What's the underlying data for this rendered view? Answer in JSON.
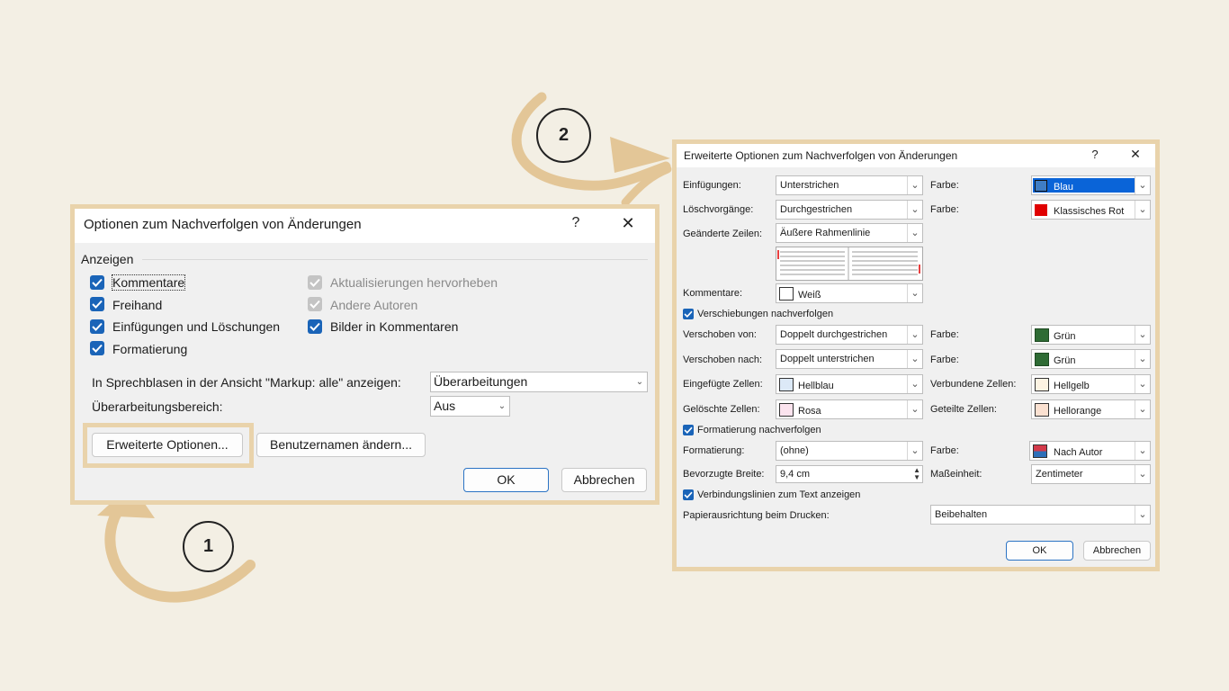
{
  "colors": {
    "background": "#f3efe4",
    "frame": "#e9d3ab",
    "checkbox": "#1a64b8",
    "arrow": "#e3c697"
  },
  "steps": {
    "one": "1",
    "two": "2"
  },
  "dialog1": {
    "title": "Optionen zum Nachverfolgen von Änderungen",
    "help": "?",
    "close": "✕",
    "section": "Anzeigen",
    "checks": {
      "kommentare": "Kommentare",
      "freihand": "Freihand",
      "einfuegungen": "Einfügungen und Löschungen",
      "formatierung": "Formatierung",
      "aktualisierungen": "Aktualisierungen hervorheben",
      "andere_autoren": "Andere Autoren",
      "bilder": "Bilder in Kommentaren"
    },
    "sprechblasen_label": "In Sprechblasen in der Ansicht \"Markup: alle\" anzeigen:",
    "sprechblasen_value": "Überarbeitungen",
    "bereich_label": "Überarbeitungsbereich:",
    "bereich_value": "Aus",
    "erweitert_button": "Erweiterte Optionen...",
    "benutzer_button": "Benutzernamen ändern...",
    "ok": "OK",
    "cancel": "Abbrechen"
  },
  "dialog2": {
    "title": "Erweiterte Optionen zum Nachverfolgen von Änderungen",
    "help": "?",
    "close": "✕",
    "einfuegungen_label": "Einfügungen:",
    "einfuegungen_value": "Unterstrichen",
    "farbe_label": "Farbe:",
    "einfuegungen_farbe": "Blau",
    "einfuegungen_farbe_hex": "#3f7dc4",
    "loesch_label": "Löschvorgänge:",
    "loesch_value": "Durchgestrichen",
    "loesch_farbe": "Klassisches Rot",
    "loesch_farbe_hex": "#e00000",
    "zeilen_label": "Geänderte Zeilen:",
    "zeilen_value": "Äußere Rahmenlinie",
    "kommentare_label": "Kommentare:",
    "kommentare_value": "Weiß",
    "kommentare_hex": "#ffffff",
    "verschiebungen_check": "Verschiebungen nachverfolgen",
    "verschoben_von_label": "Verschoben von:",
    "verschoben_von_value": "Doppelt durchgestrichen",
    "verschoben_von_farbe": "Grün",
    "gruen_hex": "#2e6b34",
    "verschoben_nach_label": "Verschoben nach:",
    "verschoben_nach_value": "Doppelt unterstrichen",
    "verschoben_nach_farbe": "Grün",
    "eingefuegte_label": "Eingefügte Zellen:",
    "eingefuegte_value": "Hellblau",
    "hellblau_hex": "#dce9f7",
    "verbundene_label": "Verbundene Zellen:",
    "verbundene_value": "Hellgelb",
    "hellgelb_hex": "#fdf3e2",
    "geloeschte_label": "Gelöschte Zellen:",
    "geloeschte_value": "Rosa",
    "rosa_hex": "#fbe3ee",
    "geteilte_label": "Geteilte Zellen:",
    "geteilte_value": "Hellorange",
    "hellorange_hex": "#fbe1d1",
    "formatierung_check": "Formatierung nachverfolgen",
    "formatierung_label": "Formatierung:",
    "formatierung_value": "(ohne)",
    "formatierung_farbe": "Nach Autor",
    "breite_label": "Bevorzugte Breite:",
    "breite_value": "9,4 cm",
    "masseinheit_label": "Maßeinheit:",
    "masseinheit_value": "Zentimeter",
    "verbindung_check": "Verbindungslinien zum Text anzeigen",
    "papier_label": "Papierausrichtung beim Drucken:",
    "papier_value": "Beibehalten",
    "ok": "OK",
    "cancel": "Abbrechen"
  }
}
